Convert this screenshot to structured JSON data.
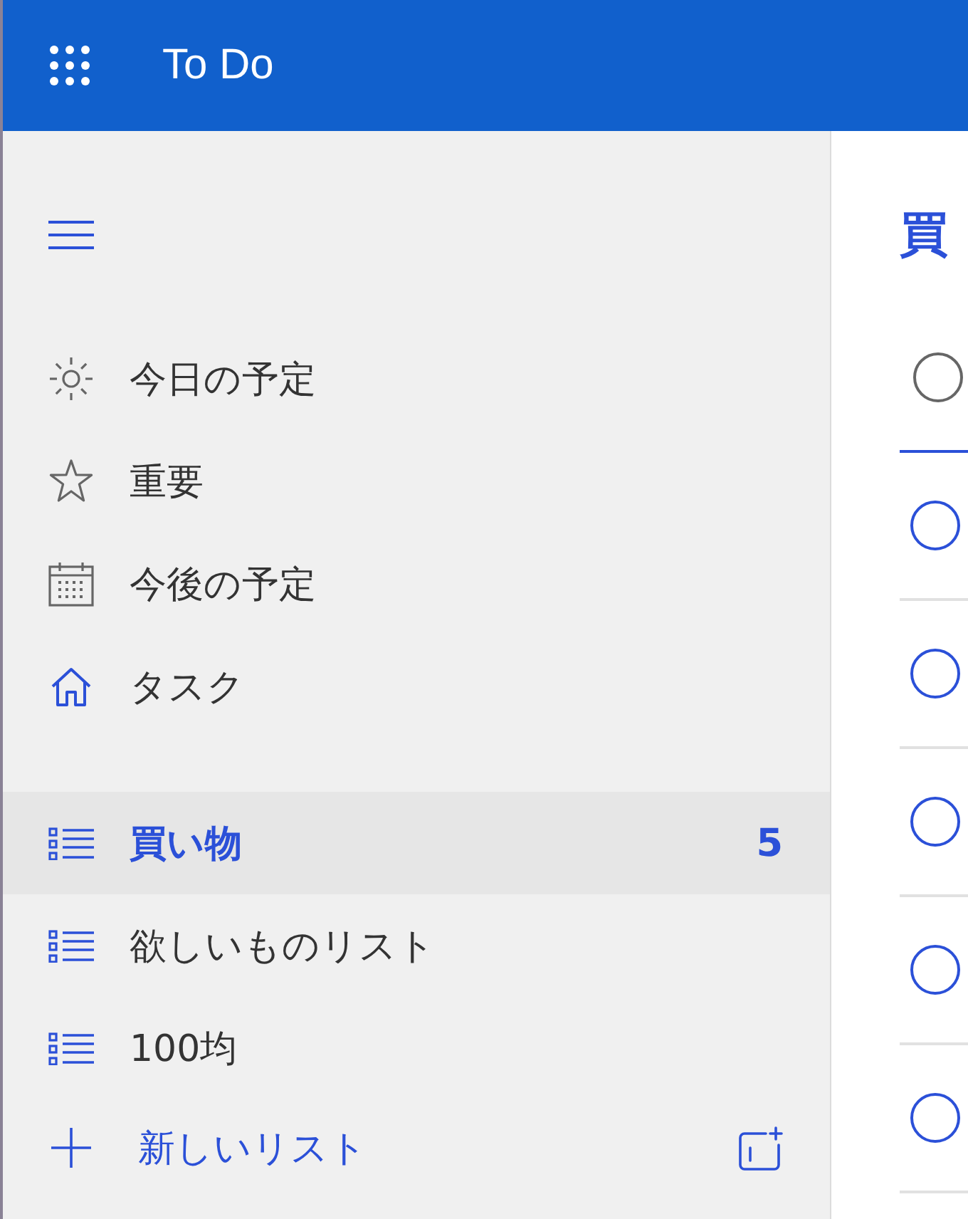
{
  "app_bar": {
    "title": "To Do"
  },
  "sidebar": {
    "nav": [
      {
        "kind": "today",
        "label": "今日の予定",
        "selected": false
      },
      {
        "kind": "important",
        "label": "重要",
        "selected": false
      },
      {
        "kind": "planned",
        "label": "今後の予定",
        "selected": false
      },
      {
        "kind": "tasks",
        "label": "タスク",
        "selected": false
      }
    ],
    "lists": [
      {
        "label": "買い物",
        "count": "5",
        "selected": true
      },
      {
        "label": "欲しいものリスト",
        "selected": false
      },
      {
        "label": "100均",
        "selected": false
      }
    ],
    "new_list": {
      "label": "新しいリスト"
    }
  },
  "list_view": {
    "title": "買",
    "add_task": {
      "focused": true
    },
    "tasks": [
      {
        "checked": false
      },
      {
        "checked": false
      },
      {
        "checked": false
      },
      {
        "checked": false
      },
      {
        "checked": false
      }
    ]
  }
}
